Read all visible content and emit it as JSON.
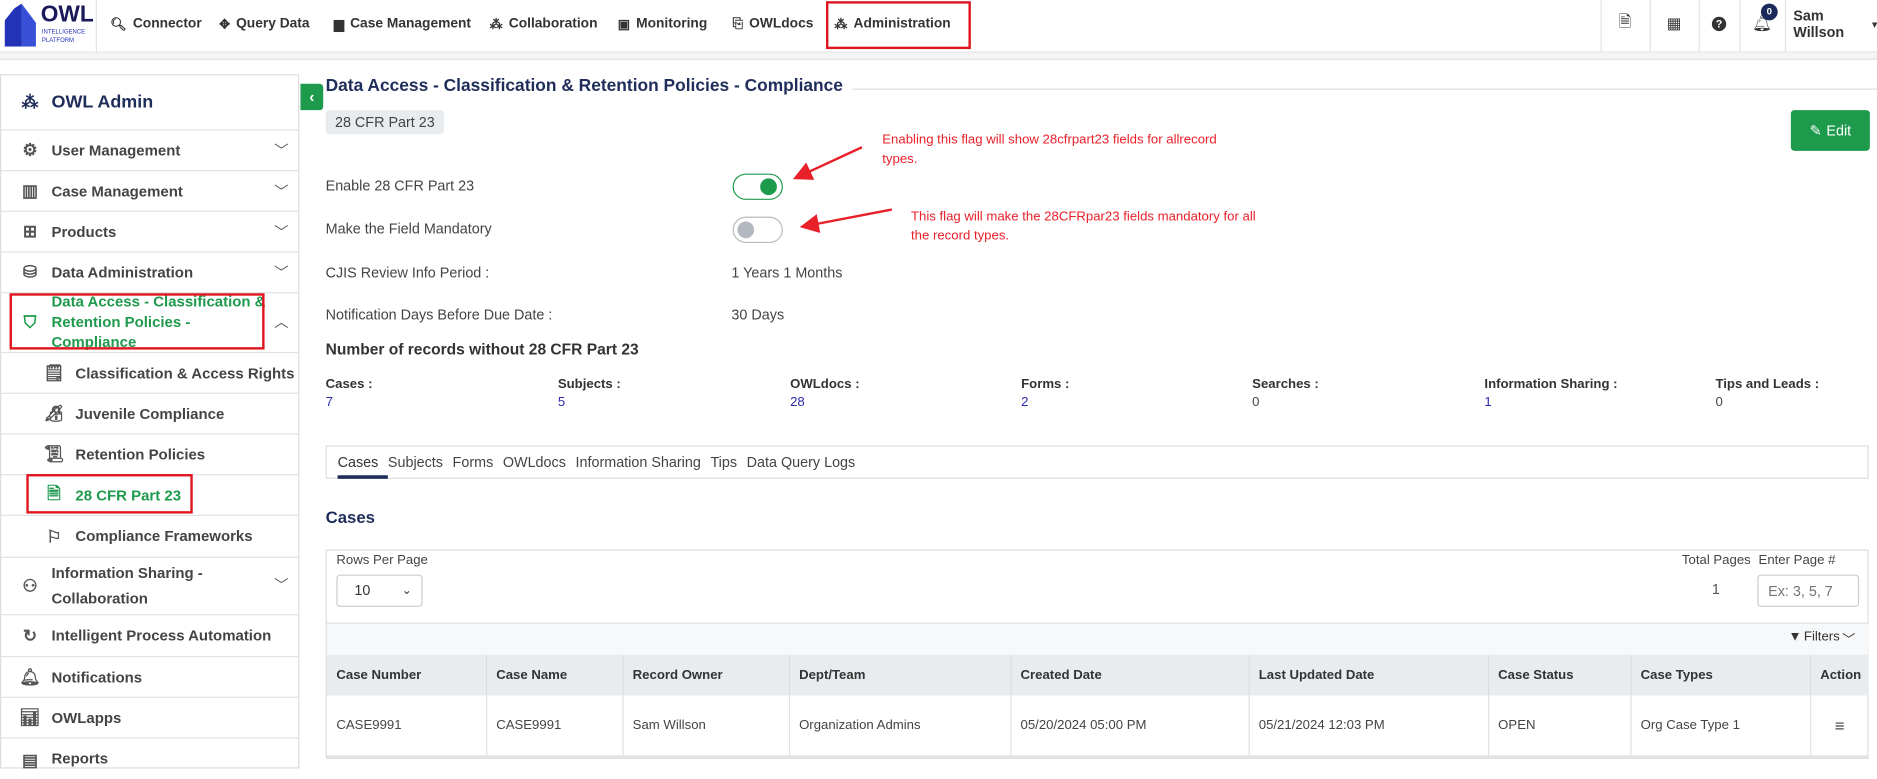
{
  "app": {
    "logo_text": "OWL",
    "logo_sub1": "INTELLIGENCE",
    "logo_sub2": "PLATFORM"
  },
  "topnav": [
    {
      "label": "Connector",
      "icon": "search-icon"
    },
    {
      "label": "Query Data",
      "icon": "move-icon"
    },
    {
      "label": "Case Management",
      "icon": "case-icon"
    },
    {
      "label": "Collaboration",
      "icon": "users-icon"
    },
    {
      "label": "Monitoring",
      "icon": "monitor-icon"
    },
    {
      "label": "OWLdocs",
      "icon": "doc-icon"
    },
    {
      "label": "Administration",
      "icon": "users-gear-icon"
    }
  ],
  "header_right": {
    "notification_count": "0",
    "user": "Sam Willson"
  },
  "sidebar": {
    "title": "OWL Admin",
    "items": [
      {
        "label": "User Management"
      },
      {
        "label": "Case Management"
      },
      {
        "label": "Products"
      },
      {
        "label": "Data Administration"
      },
      {
        "label": "Data Access - Classification & Retention Policies - Compliance",
        "active": true
      },
      {
        "label": "Classification & Access Rights"
      },
      {
        "label": "Juvenile Compliance"
      },
      {
        "label": "Retention Policies"
      },
      {
        "label": "28 CFR Part 23",
        "active": true
      },
      {
        "label": "Compliance Frameworks"
      },
      {
        "label": "Information Sharing - Collaboration"
      },
      {
        "label": "Intelligent Process Automation"
      },
      {
        "label": "Notifications"
      },
      {
        "label": "OWLapps"
      },
      {
        "label": "Reports"
      }
    ]
  },
  "main": {
    "title": "Data Access - Classification & Retention Policies - Compliance",
    "badge": "28 CFR Part 23",
    "edit_label": "Edit",
    "settings": {
      "enable_label": "Enable 28 CFR Part 23",
      "enable_on": true,
      "mandatory_label": "Make the Field Mandatory",
      "mandatory_on": false,
      "cjis_label": "CJIS Review Info Period :",
      "cjis_value": "1 Years 1 Months",
      "notif_label": "Notification Days Before Due Date :",
      "notif_value": "30 Days"
    },
    "annotations": {
      "note1": "Enabling this flag will show 28cfrpart23 fields for allrecord types.",
      "note2": "This flag will make the 28CFRpar23 fields mandatory for all the record types."
    },
    "records_heading": "Number of records without 28 CFR Part 23",
    "stats": [
      {
        "label": "Cases :",
        "value": "7"
      },
      {
        "label": "Subjects :",
        "value": "5"
      },
      {
        "label": "OWLdocs :",
        "value": "28"
      },
      {
        "label": "Forms :",
        "value": "2"
      },
      {
        "label": "Searches :",
        "value": "0"
      },
      {
        "label": "Information Sharing :",
        "value": "1"
      },
      {
        "label": "Tips and Leads :",
        "value": "0"
      }
    ],
    "tabs": [
      "Cases",
      "Subjects",
      "Forms",
      "OWLdocs",
      "Information Sharing",
      "Tips",
      "Data Query Logs"
    ],
    "active_tab": "Cases",
    "section_title": "Cases",
    "rows_per_page_label": "Rows Per Page",
    "rows_per_page": "10",
    "total_pages_label": "Total Pages",
    "total_pages": "1",
    "enter_page_label": "Enter Page #",
    "enter_page_placeholder": "Ex: 3, 5, 7",
    "filters_label": "Filters",
    "table": {
      "columns": [
        "Case Number",
        "Case Name",
        "Record Owner",
        "Dept/Team",
        "Created Date",
        "Last Updated Date",
        "Case Status",
        "Case Types",
        "Action"
      ],
      "rows": [
        [
          "CASE9991",
          "CASE9991",
          "Sam Willson",
          "Organization Admins",
          "05/20/2024 05:00 PM",
          "05/21/2024 12:03 PM",
          "OPEN",
          "Org Case Type 1"
        ]
      ]
    }
  },
  "colors": {
    "accent": "#1e9a4d",
    "navy": "#1f2d5a",
    "annotation": "#e8202a"
  }
}
